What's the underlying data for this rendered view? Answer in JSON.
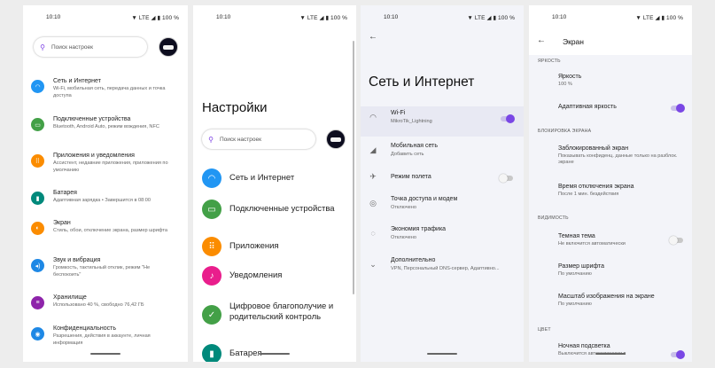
{
  "status": {
    "time": "10:10",
    "indicators": "▼ LTE ◢ ▮ 100 %"
  },
  "screen1": {
    "search_placeholder": "Поиск настроек",
    "items": [
      {
        "title": "Сеть и Интернет",
        "desc": "Wi-Fi, мобильная сеть, передача данных и точка доступа",
        "icon": "wifi-icon",
        "color": "#2196f3",
        "glyph": "◠"
      },
      {
        "title": "Подключенные устройства",
        "desc": "Bluetooth, Android Auto, режим вождения, NFC",
        "icon": "devices-icon",
        "color": "#43a047",
        "glyph": "▭"
      },
      {
        "title": "Приложения и уведомления",
        "desc": "Ассистент, недавние приложения, приложения по умолчанию",
        "icon": "apps-icon",
        "color": "#fb8c00",
        "glyph": "⠿"
      },
      {
        "title": "Батарея",
        "desc": "Адаптивная зарядка • Завершится в 08:00",
        "icon": "battery-icon",
        "color": "#00897b",
        "glyph": "▮"
      },
      {
        "title": "Экран",
        "desc": "Стиль, обои, отключение экрана, размер шрифта",
        "icon": "display-icon",
        "color": "#fb8c00",
        "glyph": "◐"
      },
      {
        "title": "Звук и вибрация",
        "desc": "Громкость, тактильный отклик, режим \"Не беспокоить\"",
        "icon": "sound-icon",
        "color": "#1e88e5",
        "glyph": "◂)"
      },
      {
        "title": "Хранилище",
        "desc": "Использовано 40 %, свободно 76,42 ГБ",
        "icon": "storage-icon",
        "color": "#8e24aa",
        "glyph": "≡"
      },
      {
        "title": "Конфиденциальность",
        "desc": "Разрешения, действия в аккаунте, личная информация",
        "icon": "privacy-icon",
        "color": "#1e88e5",
        "glyph": "◉"
      }
    ]
  },
  "screen2": {
    "title": "Настройки",
    "search_placeholder": "Поиск настроек",
    "items": [
      {
        "title": "Сеть и Интернет",
        "icon": "wifi-icon",
        "color": "#2196f3",
        "glyph": "◠"
      },
      {
        "title": "Подключенные устройства",
        "icon": "devices-icon",
        "color": "#43a047",
        "glyph": "▭"
      },
      {
        "title": "Приложения",
        "icon": "apps-icon",
        "color": "#fb8c00",
        "glyph": "⠿"
      },
      {
        "title": "Уведомления",
        "icon": "notifications-icon",
        "color": "#e91e8c",
        "glyph": "♪"
      },
      {
        "title": "Цифровое благополучие и родительский контроль",
        "icon": "wellbeing-icon",
        "color": "#43a047",
        "glyph": "✓"
      },
      {
        "title": "Батарея",
        "icon": "battery-icon",
        "color": "#00897b",
        "glyph": "▮"
      }
    ]
  },
  "screen3": {
    "title": "Сеть и Интернет",
    "items": [
      {
        "title": "Wi-Fi",
        "desc": "MikroTik_Lightning",
        "icon": "wifi-icon",
        "glyph": "◠",
        "toggle": "on"
      },
      {
        "title": "Мобильная сеть",
        "desc": "Добавить сеть",
        "icon": "signal-icon",
        "glyph": "◢",
        "toggle": ""
      },
      {
        "title": "Режим полета",
        "desc": "",
        "icon": "airplane-icon",
        "glyph": "✈",
        "toggle": "off"
      },
      {
        "title": "Точка доступа и модем",
        "desc": "Отключено",
        "icon": "hotspot-icon",
        "glyph": "◎",
        "toggle": ""
      },
      {
        "title": "Экономия трафика",
        "desc": "Отключено",
        "icon": "data-saver-icon",
        "glyph": "◌",
        "toggle": ""
      },
      {
        "title": "Дополнительно",
        "desc": "VPN, Персональный DNS-сервер, Адаптивно...",
        "icon": "chevron-down-icon",
        "glyph": "⌄",
        "toggle": ""
      }
    ]
  },
  "screen4": {
    "title": "Экран",
    "sections": {
      "brightness": "ЯРКОСТЬ",
      "lock": "БЛОКИРОВКА ЭКРАНА",
      "visibility": "ВИДИМОСТЬ",
      "color": "ЦВЕТ"
    },
    "items": {
      "brightness": {
        "title": "Яркость",
        "desc": "100 %"
      },
      "adaptive": {
        "title": "Адаптивная яркость",
        "desc": ""
      },
      "lockscreen": {
        "title": "Заблокированный экран",
        "desc": "Показывать конфиденц. данные только на разблок. экране"
      },
      "timeout": {
        "title": "Время отключения экрана",
        "desc": "После 1 мин. бездействия"
      },
      "dark": {
        "title": "Темная тема",
        "desc": "Не включится автоматически"
      },
      "fontsize": {
        "title": "Размер шрифта",
        "desc": "По умолчанию"
      },
      "scale": {
        "title": "Масштаб изображения на экране",
        "desc": "По умолчанию"
      },
      "night": {
        "title": "Ночная подсветка",
        "desc": "Выключится автоматически в"
      }
    }
  }
}
